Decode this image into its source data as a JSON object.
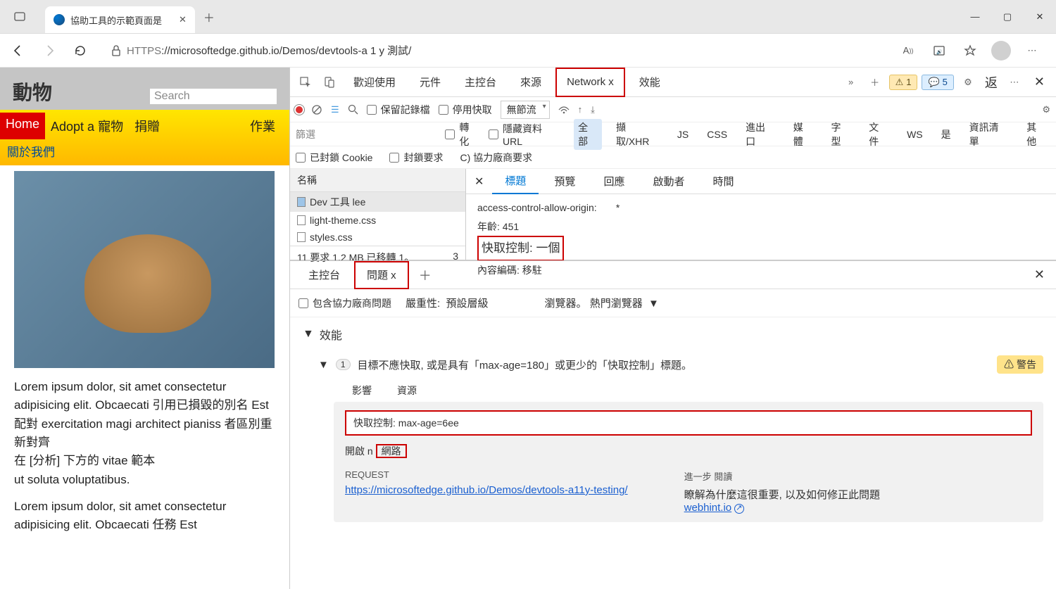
{
  "window": {
    "tab_title": "協助工具的示範頁面是",
    "url_proto": "HTTPS",
    "url_rest": "://microsoftedge.github.io/Demos/devtools-a 1 y 測試/"
  },
  "page": {
    "title": "動物",
    "search_placeholder": "Search",
    "nav": {
      "home": "Home",
      "adopt": "Adopt a 寵物",
      "donate": "捐贈",
      "jobs": "作業",
      "about": "關於我們"
    },
    "para1": "Lorem ipsum dolor, sit amet consectetur adipisicing elit. Obcaecati 引用已損毀的別名 Est 配對 exercitation magi architect pianiss 者區別重新對齊\n在 [分析] 下方的 vitae 範本\nut soluta voluptatibus.",
    "para2": "Lorem ipsum dolor, sit amet consectetur adipisicing elit. Obcaecati 任務 Est"
  },
  "devtools": {
    "tabs": {
      "welcome": "歡迎使用",
      "elements": "元件",
      "console": "主控台",
      "sources": "來源",
      "network": "Network x",
      "performance": "效能",
      "back_btn": "返"
    },
    "badges": {
      "warn_count": "1",
      "info_count": "5"
    },
    "network": {
      "preserve_log": "保留記錄檔",
      "disable_cache": "停用快取",
      "throttling": "無節流",
      "filter_label": "篩選",
      "invert": "轉化",
      "hide_data": "隱藏資料 URL",
      "types": {
        "all": "全部",
        "fetch": "擷取/XHR",
        "js": "JS",
        "css": "CSS",
        "export": "進出口",
        "media": "媒體",
        "font": "字型",
        "doc": "文件",
        "ws": "WS",
        "yes": "是",
        "manifest": "資訊清單",
        "other": "其他"
      },
      "blocked_cookies": "已封鎖 Cookie",
      "blocked_requests": "封鎖要求",
      "third_party": "C) 協力廠商要求",
      "name_header": "名稱",
      "requests": [
        {
          "name": "Dev 工具 lee",
          "type": "doc"
        },
        {
          "name": "light-theme.css",
          "type": "css"
        },
        {
          "name": "styles.css",
          "type": "css"
        }
      ],
      "status": "11 要求 1.2 MB 已移轉 1。",
      "status_right": "3",
      "detail_tabs": {
        "headers": "標題",
        "preview": "預覽",
        "response": "回應",
        "initiator": "啟動者",
        "timing": "時間"
      },
      "headers": {
        "acao": "access-control-allow-origin:",
        "acao_val": "*",
        "age": "年齡: 451",
        "cache": "快取控制: 一個",
        "encoding": "內容編碼: 移駐"
      }
    },
    "drawer": {
      "console_tab": "主控台",
      "issues_tab": "問題 x",
      "include_third": "包含協力廠商問題",
      "severity_label": "嚴重性:",
      "severity_value": "預設層級",
      "browser_label": "瀏覽器。 熱門瀏覽器",
      "category": "效能",
      "issue_count": "1",
      "issue_title": "目標不應快取, 或是具有「max-age=180」或更少的「快取控制」標題。",
      "warning_badge": "⚠ 警告",
      "col_affect": "影響",
      "col_resource": "資源",
      "code_line": "快取控制: max-age=6ee",
      "open_in": "開啟  n",
      "open_network": "網路",
      "request_h": "REQUEST",
      "request_link": "https://microsoftedge.github.io/Demos/devtools-a11y-testing/",
      "further_h": "進一步           閱讀",
      "further_text": "瞭解為什麼這很重要, 以及如何修正此問題",
      "further_link": "webhint.io"
    }
  }
}
